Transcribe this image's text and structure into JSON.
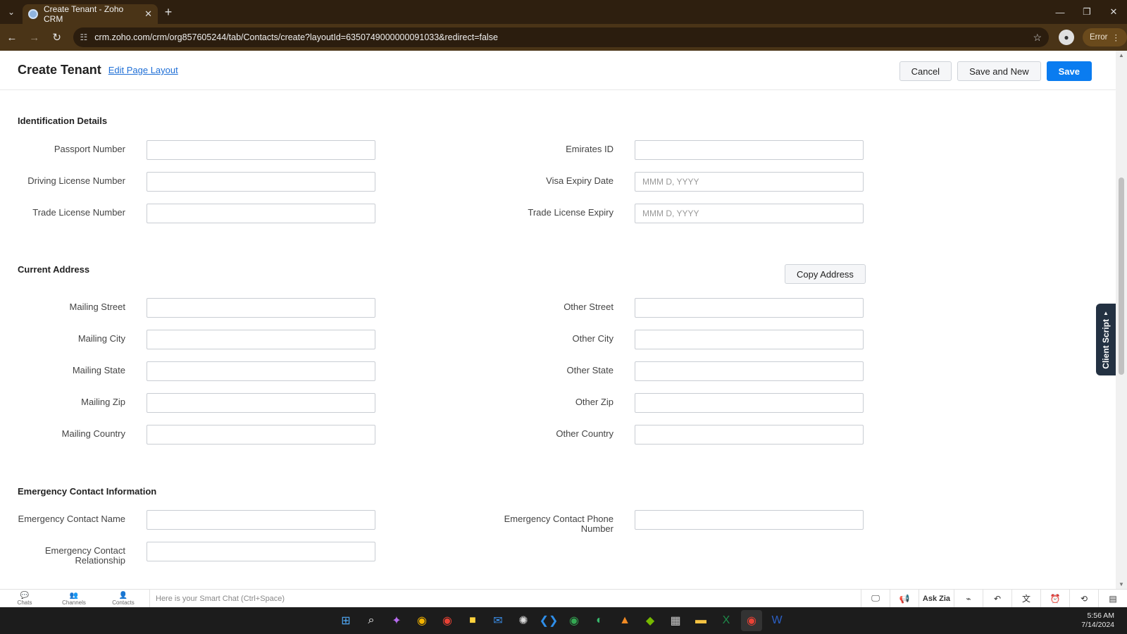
{
  "browser": {
    "tab_title": "Create Tenant - Zoho CRM",
    "url": "crm.zoho.com/crm/org857605244/tab/Contacts/create?layoutId=6350749000000091033&redirect=false",
    "error_label": "Error"
  },
  "header": {
    "title": "Create Tenant",
    "edit_layout": "Edit Page Layout",
    "cancel": "Cancel",
    "save_new": "Save and New",
    "save": "Save"
  },
  "sections": {
    "identification": {
      "title": "Identification Details",
      "passport": "Passport Number",
      "driving": "Driving License Number",
      "trade": "Trade License Number",
      "emirates": "Emirates ID",
      "visa_expiry": "Visa Expiry Date",
      "trade_expiry": "Trade License Expiry",
      "date_placeholder": "MMM D, YYYY"
    },
    "address": {
      "title": "Current Address",
      "copy_btn": "Copy Address",
      "mailing_street": "Mailing Street",
      "mailing_city": "Mailing City",
      "mailing_state": "Mailing State",
      "mailing_zip": "Mailing Zip",
      "mailing_country": "Mailing Country",
      "other_street": "Other Street",
      "other_city": "Other City",
      "other_state": "Other State",
      "other_zip": "Other Zip",
      "other_country": "Other Country"
    },
    "emergency": {
      "title": "Emergency Contact Information",
      "name": "Emergency Contact Name",
      "relationship": "Emergency Contact Relationship",
      "phone": "Emergency Contact Phone Number"
    }
  },
  "client_script": "Client Script",
  "bottom_bar": {
    "chats": "Chats",
    "channels": "Channels",
    "contacts": "Contacts",
    "smart_chat_placeholder": "Here is your Smart Chat (Ctrl+Space)",
    "ask_zia": "Ask Zia"
  },
  "taskbar": {
    "time": "5:56 AM",
    "date": "7/14/2024"
  }
}
